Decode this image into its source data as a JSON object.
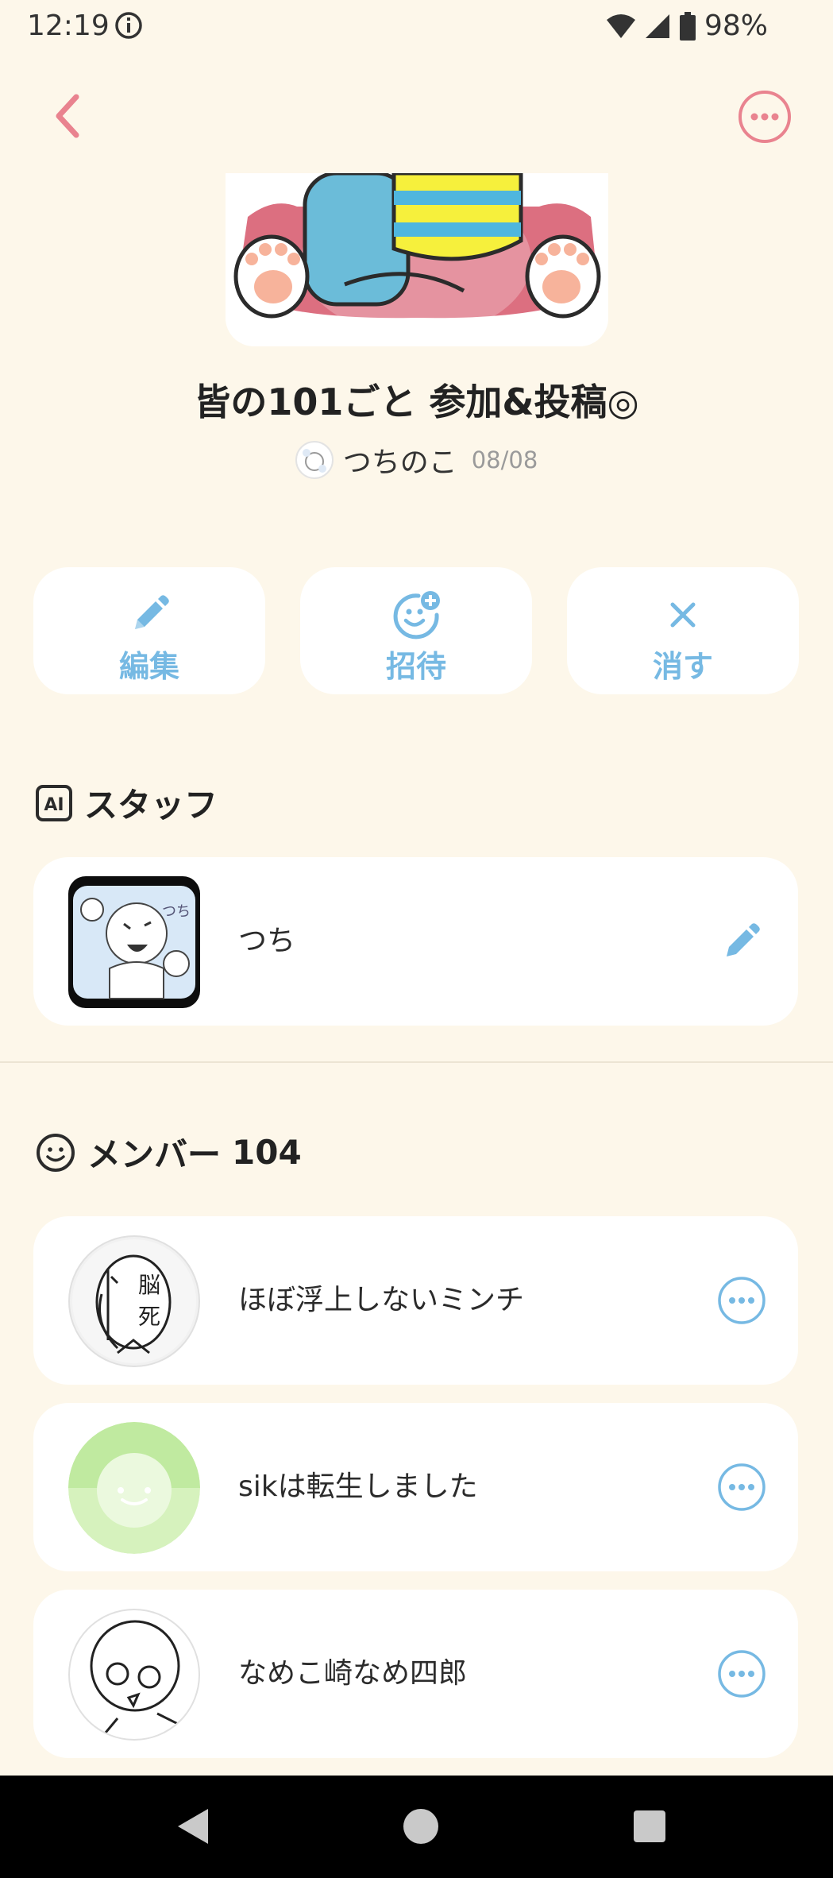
{
  "status_bar": {
    "time": "12:19",
    "battery": "98%"
  },
  "group": {
    "title": "皆の101ごと 参加&投稿◎",
    "author": "つちのこ",
    "date": "08/08"
  },
  "actions": [
    {
      "label": "編集",
      "icon": "pencil-icon"
    },
    {
      "label": "招待",
      "icon": "invite-face-icon"
    },
    {
      "label": "消す",
      "icon": "close-icon"
    }
  ],
  "staff_section": {
    "badge": "AI",
    "title": "スタッフ",
    "members": [
      {
        "name": "つち",
        "icon": "edit-pencil-icon"
      }
    ]
  },
  "member_section": {
    "title": "メンバー",
    "count": "104",
    "members": [
      {
        "name": "ほぼ浮上しないミンチ",
        "avatar_text": "脳死"
      },
      {
        "name": "sikは転生しました"
      },
      {
        "name": "なめこ崎なめ四郎"
      }
    ]
  },
  "colors": {
    "background": "#fdf7ea",
    "accent_blue": "#76b9e3",
    "accent_pink": "#e9838f",
    "card": "#ffffff"
  }
}
